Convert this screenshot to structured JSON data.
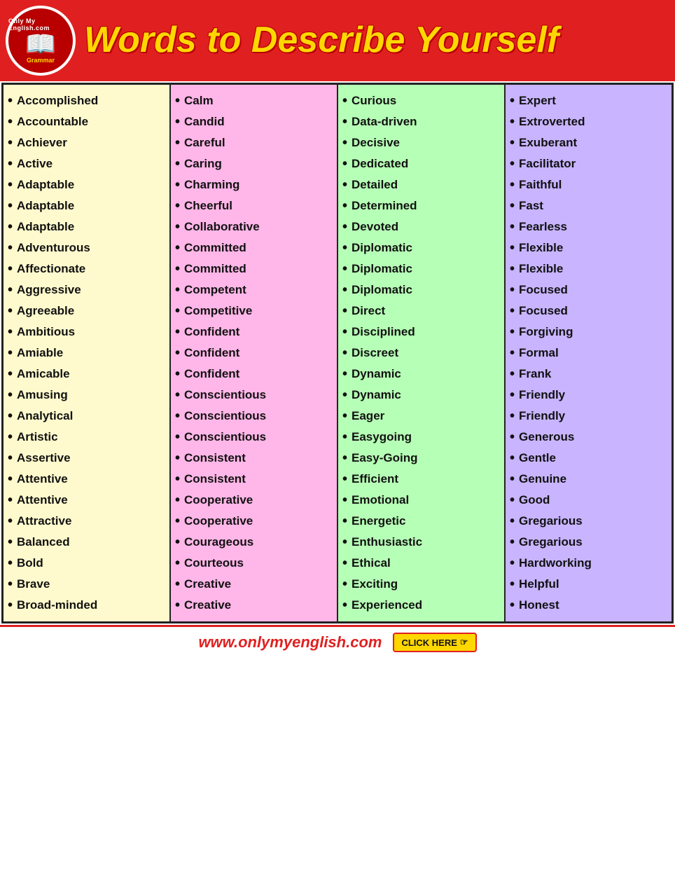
{
  "header": {
    "logo_top": "Only My English.com",
    "logo_bottom": "Grammar",
    "title": "Words to Describe Yourself"
  },
  "columns": [
    {
      "id": "col1",
      "color_class": "col-yellow",
      "items": [
        "Accomplished",
        "Accountable",
        "Achiever",
        "Active",
        "Adaptable",
        "Adaptable",
        "Adaptable",
        "Adventurous",
        "Affectionate",
        "Aggressive",
        "Agreeable",
        "Ambitious",
        "Amiable",
        "Amicable",
        "Amusing",
        "Analytical",
        "Artistic",
        "Assertive",
        "Attentive",
        "Attentive",
        "Attractive",
        "Balanced",
        "Bold",
        "Brave",
        "Broad-minded"
      ]
    },
    {
      "id": "col2",
      "color_class": "col-pink",
      "items": [
        "Calm",
        "Candid",
        "Careful",
        "Caring",
        "Charming",
        "Cheerful",
        "Collaborative",
        "Committed",
        "Committed",
        "Competent",
        "Competitive",
        "Confident",
        "Confident",
        "Confident",
        "Conscientious",
        "Conscientious",
        "Conscientious",
        "Consistent",
        "Consistent",
        "Cooperative",
        "Cooperative",
        "Courageous",
        "Courteous",
        "Creative",
        "Creative"
      ]
    },
    {
      "id": "col3",
      "color_class": "col-green",
      "items": [
        "Curious",
        "Data-driven",
        "Decisive",
        "Dedicated",
        "Detailed",
        "Determined",
        "Devoted",
        "Diplomatic",
        "Diplomatic",
        "Diplomatic",
        "Direct",
        "Disciplined",
        "Discreet",
        "Dynamic",
        "Dynamic",
        "Eager",
        "Easygoing",
        "Easy-Going",
        "Efficient",
        "Emotional",
        "Energetic",
        "Enthusiastic",
        "Ethical",
        "Exciting",
        "Experienced"
      ]
    },
    {
      "id": "col4",
      "color_class": "col-purple",
      "items": [
        "Expert",
        "Extroverted",
        "Exuberant",
        "Facilitator",
        "Faithful",
        "Fast",
        "Fearless",
        "Flexible",
        "Flexible",
        "Focused",
        "Focused",
        "Forgiving",
        "Formal",
        "Frank",
        "Friendly",
        "Friendly",
        "Generous",
        "Gentle",
        "Genuine",
        "Good",
        "Gregarious",
        "Gregarious",
        "Hardworking",
        "Helpful",
        "Honest"
      ]
    }
  ],
  "footer": {
    "url": "www.onlymyenglish.com",
    "btn_label": "CLICK HERE"
  }
}
